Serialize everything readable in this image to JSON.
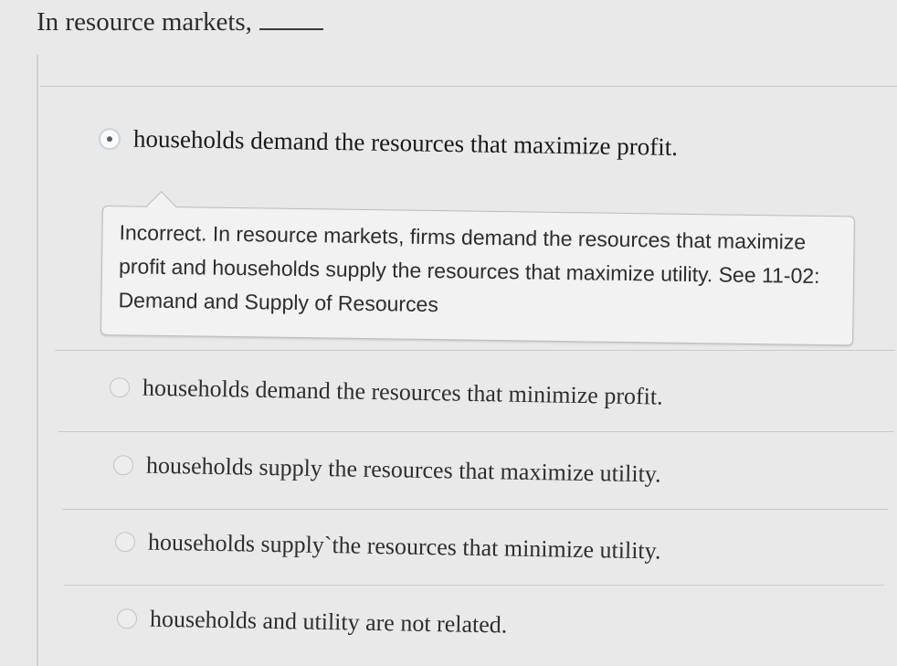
{
  "question": {
    "text": "In resource markets,"
  },
  "selected_option": {
    "label": "households demand the resources that maximize profit."
  },
  "feedback": {
    "status": "Incorrect.",
    "body": "In resource markets, firms demand the resources that maximize profit and households supply the resources that maximize utility.",
    "see": "See",
    "link": "11-02: Demand and Supply of Resources"
  },
  "options": [
    {
      "label": "households demand the resources that minimize profit."
    },
    {
      "label": "households supply the resources that maximize utility."
    },
    {
      "label": "households supply`the resources that minimize utility."
    },
    {
      "label": "households and utility are not related."
    }
  ]
}
